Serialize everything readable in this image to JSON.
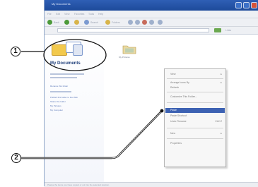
{
  "window": {
    "title": "My Documents",
    "menu_items": [
      "File",
      "Edit",
      "View",
      "Favorites",
      "Tools",
      "Help"
    ],
    "toolbar_labels": [
      "Back",
      "Search",
      "Folders"
    ],
    "links_label": "Links"
  },
  "taskpane": {
    "folder_title": "My Documents",
    "links": [
      "Rename this folder",
      "Publish this folder to the Web",
      "Share this folder",
      "My Pictures",
      "My Computer"
    ]
  },
  "files": [
    {
      "label": "My Pictures"
    }
  ],
  "context_menu": {
    "items": [
      {
        "label": "View",
        "submenu": true
      },
      {
        "label": "Arrange Icons By",
        "submenu": true
      },
      {
        "label": "Refresh",
        "submenu": false
      },
      {
        "label": "Customize This Folder...",
        "submenu": false
      },
      {
        "label": "Paste",
        "submenu": false,
        "selected": true
      },
      {
        "label": "Paste Shortcut",
        "submenu": false
      },
      {
        "label": "Undo Rename",
        "submenu": false,
        "shortcut": "Ctrl+Z"
      },
      {
        "label": "New",
        "submenu": true
      },
      {
        "label": "Properties",
        "submenu": false
      }
    ]
  },
  "statusbar": {
    "text": "Pastes the items you have copied or cut into the selected location."
  },
  "callouts": [
    {
      "number": "1"
    },
    {
      "number": "2"
    }
  ],
  "colors": {
    "titlebar": "#1d4a9a",
    "selection": "#3d62b3",
    "folder": "#f2c94c"
  }
}
